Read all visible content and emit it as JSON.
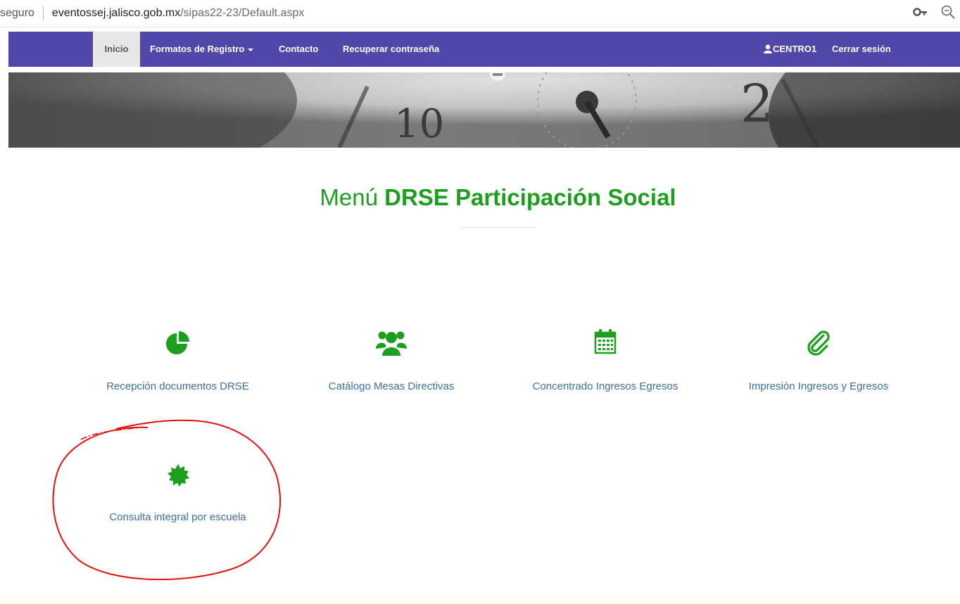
{
  "browser": {
    "security_text": "seguro",
    "url_host": "eventossej.jalisco.gob.mx",
    "url_path": "/sipas22-23/Default.aspx",
    "icons": [
      "key-icon",
      "zoom-icon"
    ]
  },
  "nav": {
    "inicio": "Inicio",
    "formatos": "Formatos de Registro",
    "contacto": "Contacto",
    "recuperar": "Recuperar contraseña",
    "user": "CENTRO1",
    "logout": "Cerrar sesión",
    "colors": {
      "bar": "#5047a9",
      "active_bg": "#e7e7e7"
    }
  },
  "heading": {
    "light": "Menú",
    "bold": "DRSE Participación Social",
    "color": "#1e9e1e"
  },
  "menu": {
    "items": [
      {
        "label": "Recepción documentos DRSE",
        "icon": "pie-chart-icon"
      },
      {
        "label": "Catálogo Mesas Directivas",
        "icon": "users-icon"
      },
      {
        "label": "Concentrado Ingresos Egresos",
        "icon": "calendar-icon"
      },
      {
        "label": "Impresión Ingresos y Egresos",
        "icon": "paperclip-icon"
      },
      {
        "label": "Consulta integral por escuela",
        "icon": "certificate-icon"
      }
    ],
    "icon_color": "#1e9e1e",
    "label_color": "#3e6e9e"
  }
}
